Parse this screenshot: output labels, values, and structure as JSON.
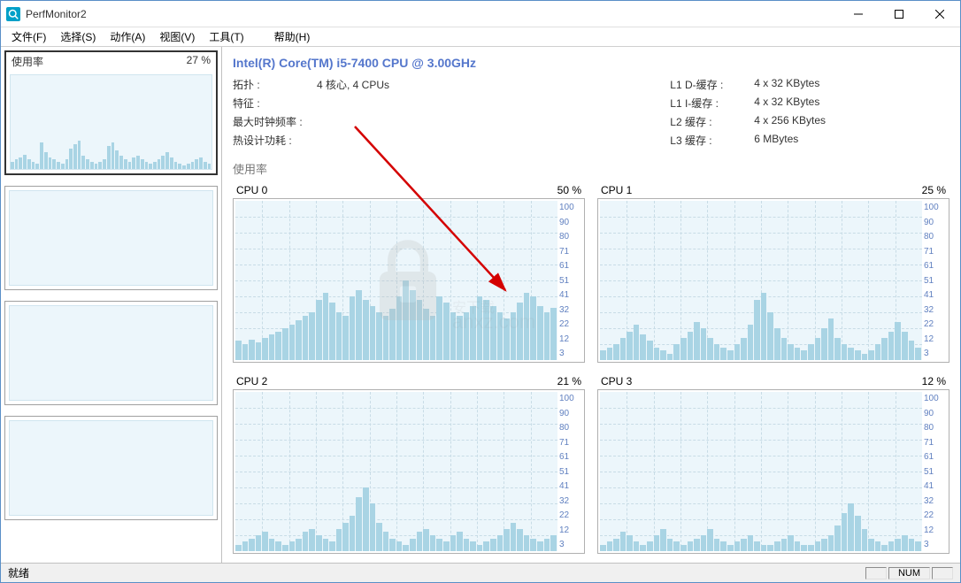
{
  "window": {
    "title": "PerfMonitor2"
  },
  "menu": {
    "items": [
      "文件(F)",
      "选择(S)",
      "动作(A)",
      "视图(V)",
      "工具(T)",
      "帮助(H)"
    ]
  },
  "sidebar": {
    "header_label": "使用率",
    "header_value": "27 %"
  },
  "cpu": {
    "title": "Intel(R) Core(TM) i5-7400 CPU @ 3.00GHz",
    "rows_left": [
      {
        "label": "拓扑 :",
        "value": "4 核心, 4 CPUs"
      },
      {
        "label": "特征 :",
        "value": ""
      },
      {
        "label": "最大时钟频率 :",
        "value": ""
      },
      {
        "label": "热设计功耗 :",
        "value": ""
      }
    ],
    "rows_right": [
      {
        "label": "L1 D-缓存 :",
        "value": "4 x 32 KBytes"
      },
      {
        "label": "L1 I-缓存 :",
        "value": "4 x 32 KBytes"
      },
      {
        "label": "L2 缓存 :",
        "value": "4 x 256 KBytes"
      },
      {
        "label": "L3 缓存 :",
        "value": "6 MBytes"
      }
    ],
    "section": "使用率"
  },
  "chart_data": {
    "ylabels": [
      "100",
      "90",
      "80",
      "71",
      "61",
      "51",
      "41",
      "32",
      "22",
      "12",
      "3"
    ],
    "overview": [
      8,
      10,
      12,
      15,
      10,
      8,
      6,
      28,
      18,
      12,
      10,
      8,
      6,
      10,
      22,
      26,
      30,
      14,
      10,
      8,
      6,
      8,
      10,
      25,
      28,
      20,
      14,
      10,
      8,
      12,
      14,
      10,
      8,
      6,
      8,
      10,
      14,
      18,
      12,
      8,
      6,
      4,
      6,
      8,
      10,
      12,
      8,
      6
    ],
    "cores": [
      {
        "name": "CPU 0",
        "pct": "50 %",
        "values": [
          12,
          10,
          13,
          11,
          14,
          16,
          18,
          20,
          22,
          25,
          28,
          30,
          38,
          42,
          36,
          30,
          28,
          40,
          44,
          38,
          34,
          30,
          28,
          32,
          40,
          50,
          44,
          38,
          32,
          28,
          40,
          36,
          30,
          28,
          30,
          34,
          40,
          38,
          34,
          30,
          26,
          30,
          36,
          42,
          40,
          34,
          30,
          33
        ]
      },
      {
        "name": "CPU 1",
        "pct": "25 %",
        "values": [
          6,
          8,
          10,
          14,
          18,
          22,
          16,
          12,
          8,
          6,
          4,
          10,
          14,
          18,
          24,
          20,
          14,
          10,
          8,
          6,
          10,
          14,
          22,
          38,
          42,
          30,
          20,
          14,
          10,
          8,
          6,
          10,
          14,
          20,
          26,
          14,
          10,
          8,
          6,
          4,
          6,
          10,
          14,
          18,
          24,
          18,
          12,
          8
        ]
      },
      {
        "name": "CPU 2",
        "pct": "21 %",
        "values": [
          4,
          6,
          8,
          10,
          12,
          8,
          6,
          4,
          6,
          8,
          12,
          14,
          10,
          8,
          6,
          14,
          18,
          22,
          34,
          40,
          30,
          18,
          12,
          8,
          6,
          4,
          8,
          12,
          14,
          10,
          8,
          6,
          10,
          12,
          8,
          6,
          4,
          6,
          8,
          10,
          14,
          18,
          14,
          10,
          8,
          6,
          8,
          10
        ]
      },
      {
        "name": "CPU 3",
        "pct": "12 %",
        "values": [
          4,
          6,
          8,
          12,
          10,
          6,
          4,
          6,
          10,
          14,
          8,
          6,
          4,
          6,
          8,
          10,
          14,
          8,
          6,
          4,
          6,
          8,
          10,
          6,
          4,
          4,
          6,
          8,
          10,
          6,
          4,
          4,
          6,
          8,
          10,
          16,
          24,
          30,
          22,
          14,
          8,
          6,
          4,
          6,
          8,
          10,
          8,
          6
        ]
      }
    ]
  },
  "status": {
    "left": "就绪",
    "num": "NUM"
  },
  "watermark": {
    "host": "anxz",
    "tld": ".com",
    "alt": "安下载"
  }
}
